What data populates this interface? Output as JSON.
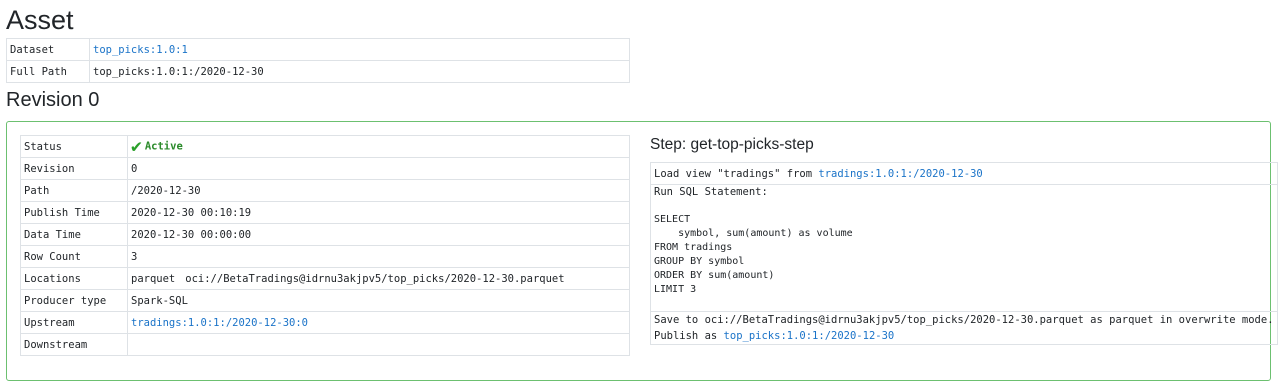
{
  "asset": {
    "title": "Asset",
    "dataset_label": "Dataset",
    "dataset_value": "top_picks:1.0:1",
    "full_path_label": "Full Path",
    "full_path_value": "top_picks:1.0:1:/2020-12-30"
  },
  "revision": {
    "title": "Revision 0",
    "status_label": "Status",
    "status_value": "Active",
    "revision_label": "Revision",
    "revision_value": "0",
    "path_label": "Path",
    "path_value": "/2020-12-30",
    "publish_time_label": "Publish Time",
    "publish_time_value": "2020-12-30 00:10:19",
    "data_time_label": "Data Time",
    "data_time_value": "2020-12-30 00:00:00",
    "row_count_label": "Row Count",
    "row_count_value": "3",
    "locations_label": "Locations",
    "locations_format": "parquet",
    "locations_value": "oci://BetaTradings@idrnu3akjpv5/top_picks/2020-12-30.parquet",
    "producer_type_label": "Producer type",
    "producer_type_value": "Spark-SQL",
    "upstream_label": "Upstream",
    "upstream_value": "tradings:1.0:1:/2020-12-30:0",
    "downstream_label": "Downstream",
    "downstream_value": ""
  },
  "step": {
    "title": "Step: get-top-picks-step",
    "load_prefix": "Load view \"tradings\" from ",
    "load_link": "tradings:1.0:1:/2020-12-30",
    "sql_label": "Run SQL Statement:",
    "sql_body": "\nSELECT\n    symbol, sum(amount) as volume\nFROM tradings\nGROUP BY symbol\nORDER BY sum(amount)\nLIMIT 3",
    "save_text": "Save to oci://BetaTradings@idrnu3akjpv5/top_picks/2020-12-30.parquet as parquet in overwrite mode.",
    "publish_prefix": "Publish as ",
    "publish_link": "top_picks:1.0:1:/2020-12-30"
  },
  "colors": {
    "link": "#1a73c8",
    "active": "#2a8a2a",
    "box_border": "#6cc070"
  },
  "icons": {
    "status": "checkmark-icon"
  }
}
